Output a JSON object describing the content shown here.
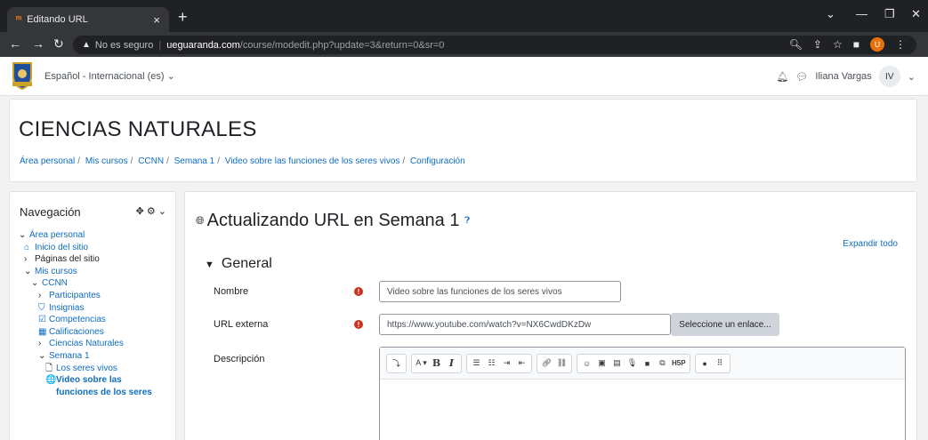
{
  "browser": {
    "tab_title": "Editando URL",
    "tab_favicon": "moodle-icon",
    "tab_close": "×",
    "new_tab": "+",
    "url_insecure_label": "No es seguro",
    "url_domain": "ueguaranda.com",
    "url_path": "/course/modedit.php?update=3&return=0&sr=0",
    "profile_initial": "U"
  },
  "navbar": {
    "language": "Español - Internacional (es) ⌄",
    "user_name": "Iliana Vargas",
    "user_initials": "IV"
  },
  "course": {
    "title": "CIENCIAS NATURALES",
    "breadcrumb": [
      "Área personal",
      "Mis cursos",
      "CCNN",
      "Semana 1",
      "Video sobre las funciones de los seres vivos",
      "Configuración"
    ],
    "breadcrumb_sep": "/"
  },
  "nav_block": {
    "title": "Navegación",
    "items": [
      {
        "label": "Área personal",
        "prefix": "⌄"
      },
      {
        "label": "Inicio del sitio",
        "prefix": "⌂"
      },
      {
        "label": "Páginas del sitio",
        "prefix": "›"
      },
      {
        "label": "Mis cursos",
        "prefix": "⌄"
      },
      {
        "label": "CCNN",
        "prefix": "⌄"
      },
      {
        "label": "Participantes",
        "prefix": "›"
      },
      {
        "label": "Insignias",
        "prefix": "⛉"
      },
      {
        "label": "Competencias",
        "prefix": "☑"
      },
      {
        "label": "Calificaciones",
        "prefix": "▦"
      },
      {
        "label": "Ciencias Naturales",
        "prefix": "›"
      },
      {
        "label": "Semana 1",
        "prefix": "⌄"
      },
      {
        "label": "Los seres vivos",
        "prefix": "🗋"
      },
      {
        "label": "Video sobre las",
        "prefix": "🌐"
      },
      {
        "label": "funciones de los seres",
        "prefix": ""
      }
    ]
  },
  "main": {
    "heading": "Actualizando URL en Semana 1",
    "expand_all": "Expandir todo",
    "section_title": "General",
    "fields": {
      "name_label": "Nombre",
      "name_value": "Video sobre las funciones de los seres vivos",
      "url_label": "URL externa",
      "url_value": "https://www.youtube.com/watch?v=NX6CwdDKzDw",
      "select_link_button": "Seleccione un enlace...",
      "description_label": "Descripción",
      "required_mark": "!"
    }
  },
  "colors": {
    "link": "#0f6cbf",
    "required": "#ca3120",
    "chrome_dark": "#202124"
  }
}
